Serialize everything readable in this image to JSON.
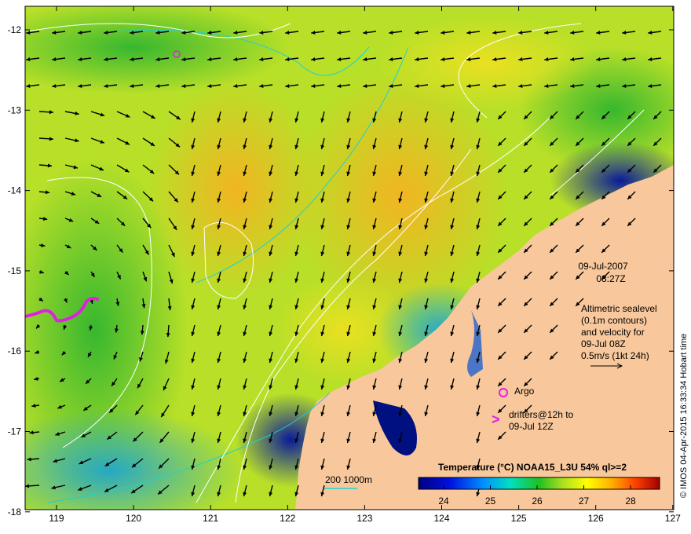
{
  "map": {
    "x_ticks": [
      "119",
      "120",
      "121",
      "122",
      "123",
      "124",
      "125",
      "126",
      "127"
    ],
    "y_ticks": [
      "-12",
      "-13",
      "-14",
      "-15",
      "-16",
      "-17",
      "-18"
    ]
  },
  "info": {
    "date": "09-Jul-2007",
    "time": "08:27Z",
    "sealevel_lines": [
      "Altimetric sealevel",
      "(0.1m contours)",
      "and velocity for",
      "09-Jul 08Z",
      "0.5m/s (1kt 24h)"
    ],
    "argo_label": "Argo",
    "drifters_lines": [
      "drifters@12h to",
      "09-Jul 12Z"
    ]
  },
  "scale": {
    "label": "200  1000m"
  },
  "colorbar": {
    "title": "Temperature (°C) NOAA15_L3U 54% ql>=2",
    "ticks": [
      "24",
      "25",
      "26",
      "27",
      "28"
    ]
  },
  "credit": "© IMOS 04-Apr-2015 16:33:34 Hobart time",
  "colors": {
    "land": "#f8c89c",
    "contour": "#ffffff",
    "bathymetry": "#1fd0d0",
    "argo": "#e020e0",
    "drifters": "#e020e0"
  }
}
